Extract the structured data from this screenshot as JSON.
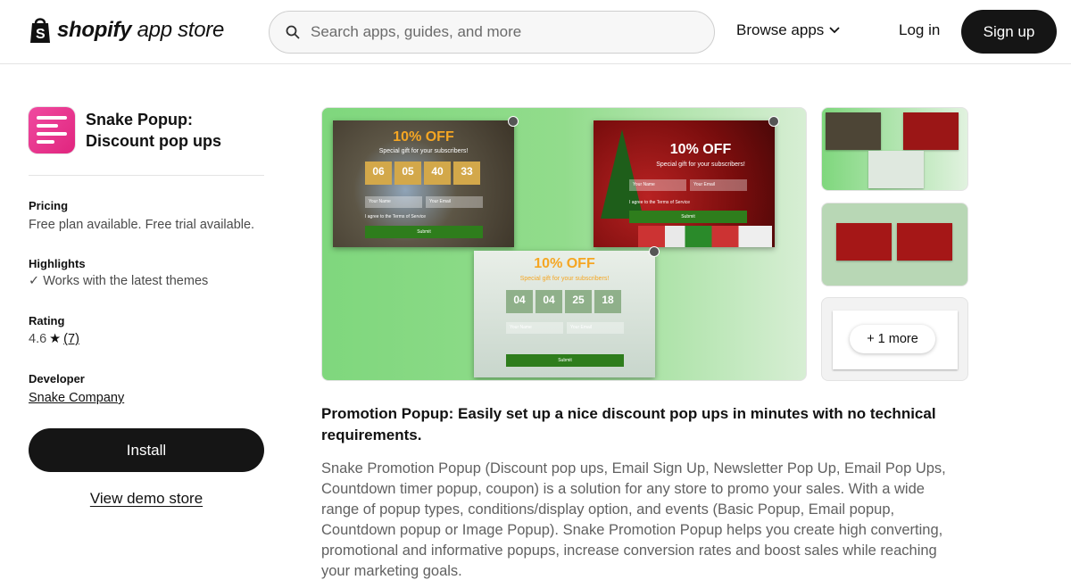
{
  "header": {
    "logo_brand": "shopify",
    "logo_suffix": "app store",
    "search_placeholder": "Search apps, guides, and more",
    "browse_label": "Browse apps",
    "login_label": "Log in",
    "signup_label": "Sign up"
  },
  "app": {
    "name": "Snake Popup: Discount pop ups",
    "pricing_label": "Pricing",
    "pricing_value": "Free plan available. Free trial available.",
    "highlights_label": "Highlights",
    "highlights_value": "Works with the latest themes",
    "rating_label": "Rating",
    "rating_value": "4.6",
    "rating_count": "(7)",
    "developer_label": "Developer",
    "developer_value": "Snake Company",
    "install_label": "Install",
    "demo_label": "View demo store"
  },
  "gallery": {
    "popup1": {
      "offer": "10% OFF",
      "gift": "Special gift for your subscribers!",
      "timer": [
        "06",
        "05",
        "40",
        "33"
      ],
      "name_field": "Your Name",
      "email_field": "Your Email",
      "submit": "Submit",
      "terms": "I agree to the Terms of Service"
    },
    "popup2": {
      "offer": "10% OFF",
      "gift": "Special gift for your subscribers!",
      "name_field": "Your Name",
      "email_field": "Your Email",
      "submit": "Submit",
      "terms": "I agree to the Terms of Service"
    },
    "popup3": {
      "offer": "10% OFF",
      "gift": "Special gift for your subscribers!",
      "timer": [
        "04",
        "04",
        "25",
        "18"
      ],
      "name_field": "Your Name",
      "email_field": "Your Email",
      "submit": "Submit"
    },
    "more_label": "+ 1 more"
  },
  "description": {
    "title": "Promotion Popup: Easily set up a nice discount pop ups in minutes with no technical requirements.",
    "body": "Snake Promotion Popup (Discount pop ups, Email Sign Up, Newsletter Pop Up, Email Pop Ups, Countdown timer popup, coupon) is a solution for any store to promo your sales. With a wide range of popup types, conditions/display option, and events (Basic Popup, Email popup, Countdown popup or Image Popup). Snake Promotion Popup helps you create high converting, promotional and informative popups, increase conversion rates and boost sales while reaching your marketing goals."
  },
  "colors": {
    "dark_button": "#151515",
    "accent_green": "#7fd77d",
    "offer_orange": "#f5a623",
    "app_icon_pink": "#e0257e"
  }
}
